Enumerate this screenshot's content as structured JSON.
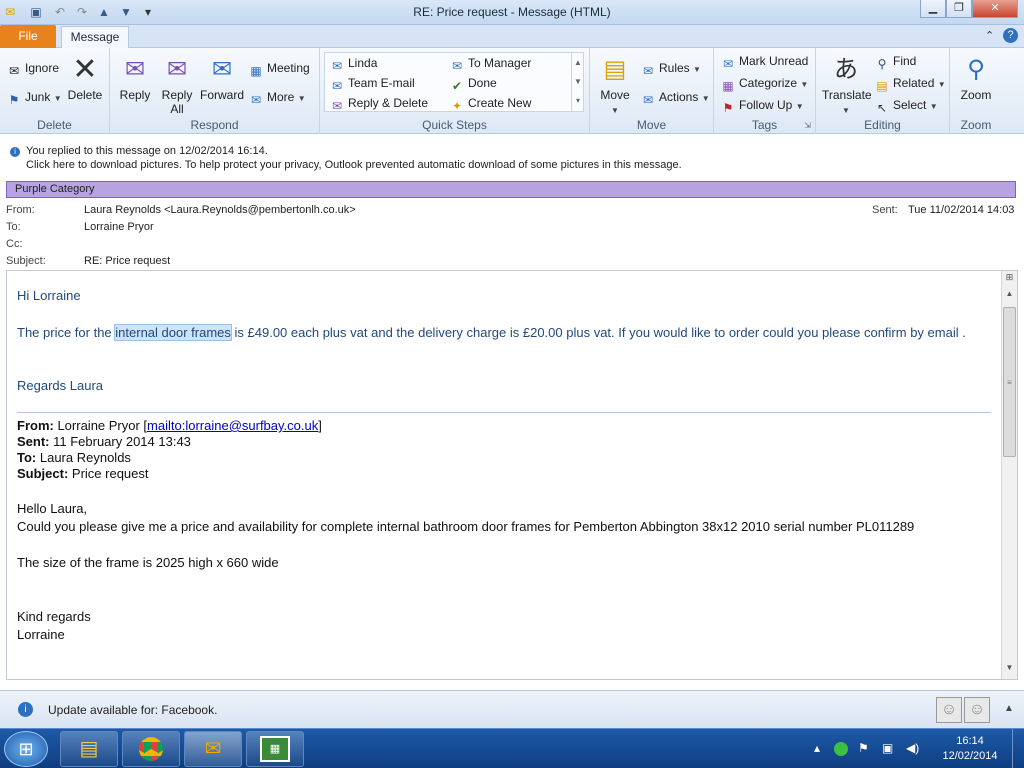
{
  "window": {
    "title": "RE: Price request  -  Message (HTML)"
  },
  "tabs": {
    "file": "File",
    "message": "Message"
  },
  "ribbon": {
    "delete_group": {
      "label": "Delete",
      "ignore": "Ignore",
      "junk": "Junk",
      "delete": "Delete"
    },
    "respond_group": {
      "label": "Respond",
      "reply": "Reply",
      "reply_all_1": "Reply",
      "reply_all_2": "All",
      "forward": "Forward",
      "meeting": "Meeting",
      "more": "More"
    },
    "quick_steps": {
      "label": "Quick Steps",
      "items": [
        "Linda",
        "To Manager",
        "Team E-mail",
        "Done",
        "Reply & Delete",
        "Create New"
      ]
    },
    "move_group": {
      "label": "Move",
      "move": "Move",
      "rules": "Rules",
      "actions": "Actions"
    },
    "tags_group": {
      "label": "Tags",
      "mark_unread": "Mark Unread",
      "categorize": "Categorize",
      "follow_up": "Follow Up"
    },
    "editing_group": {
      "label": "Editing",
      "translate": "Translate",
      "find": "Find",
      "related": "Related",
      "select": "Select"
    },
    "zoom_group": {
      "label": "Zoom",
      "zoom": "Zoom"
    }
  },
  "info": {
    "replied": "You replied to this message on 12/02/2014 16:14.",
    "pictures": "Click here to download pictures. To help protect your privacy, Outlook prevented automatic download of some pictures in this message."
  },
  "category": "Purple Category",
  "header": {
    "from_label": "From:",
    "from_value": "Laura Reynolds <Laura.Reynolds@pembertonlh.co.uk>",
    "to_label": "To:",
    "to_value": "Lorraine Pryor",
    "cc_label": "Cc:",
    "subject_label": "Subject:",
    "subject_value": "RE: Price request",
    "sent_label": "Sent:",
    "sent_value": "Tue 11/02/2014 14:03"
  },
  "body": {
    "greeting": "Hi Lorraine",
    "price_pre": "The price for the ",
    "price_hl": "internal door frames",
    "price_post": " is £49.00 each  plus vat and the delivery charge is £20.00 plus vat. If you would like to order could you please confirm by email .",
    "regards": "Regards Laura",
    "orig_from_label": "From:",
    "orig_from_name": " Lorraine Pryor [",
    "orig_from_link": "mailto:lorraine@surfbay.co.uk",
    "orig_from_end": "]",
    "orig_sent_label": "Sent:",
    "orig_sent_value": " 11 February 2014 13:43",
    "orig_to_label": "To:",
    "orig_to_value": " Laura Reynolds",
    "orig_subject_label": "Subject:",
    "orig_subject_value": " Price request",
    "hello": "Hello Laura,",
    "request": "Could you please give me a price and availability for complete internal  bathroom door frames for Pemberton Abbington 38x12 2010 serial number PL011289",
    "size": "The size of the frame is 2025 high x 660 wide",
    "kind": "Kind regards",
    "sign": "Lorraine"
  },
  "status": {
    "update": "Update available for: Facebook."
  },
  "taskbar": {
    "time": "16:14",
    "date": "12/02/2014"
  },
  "colors": {
    "file_tab": "#e8821b",
    "category": "#b6a3e0",
    "reply_text": "#1f497d",
    "taskbar": "#1d5aa8"
  }
}
